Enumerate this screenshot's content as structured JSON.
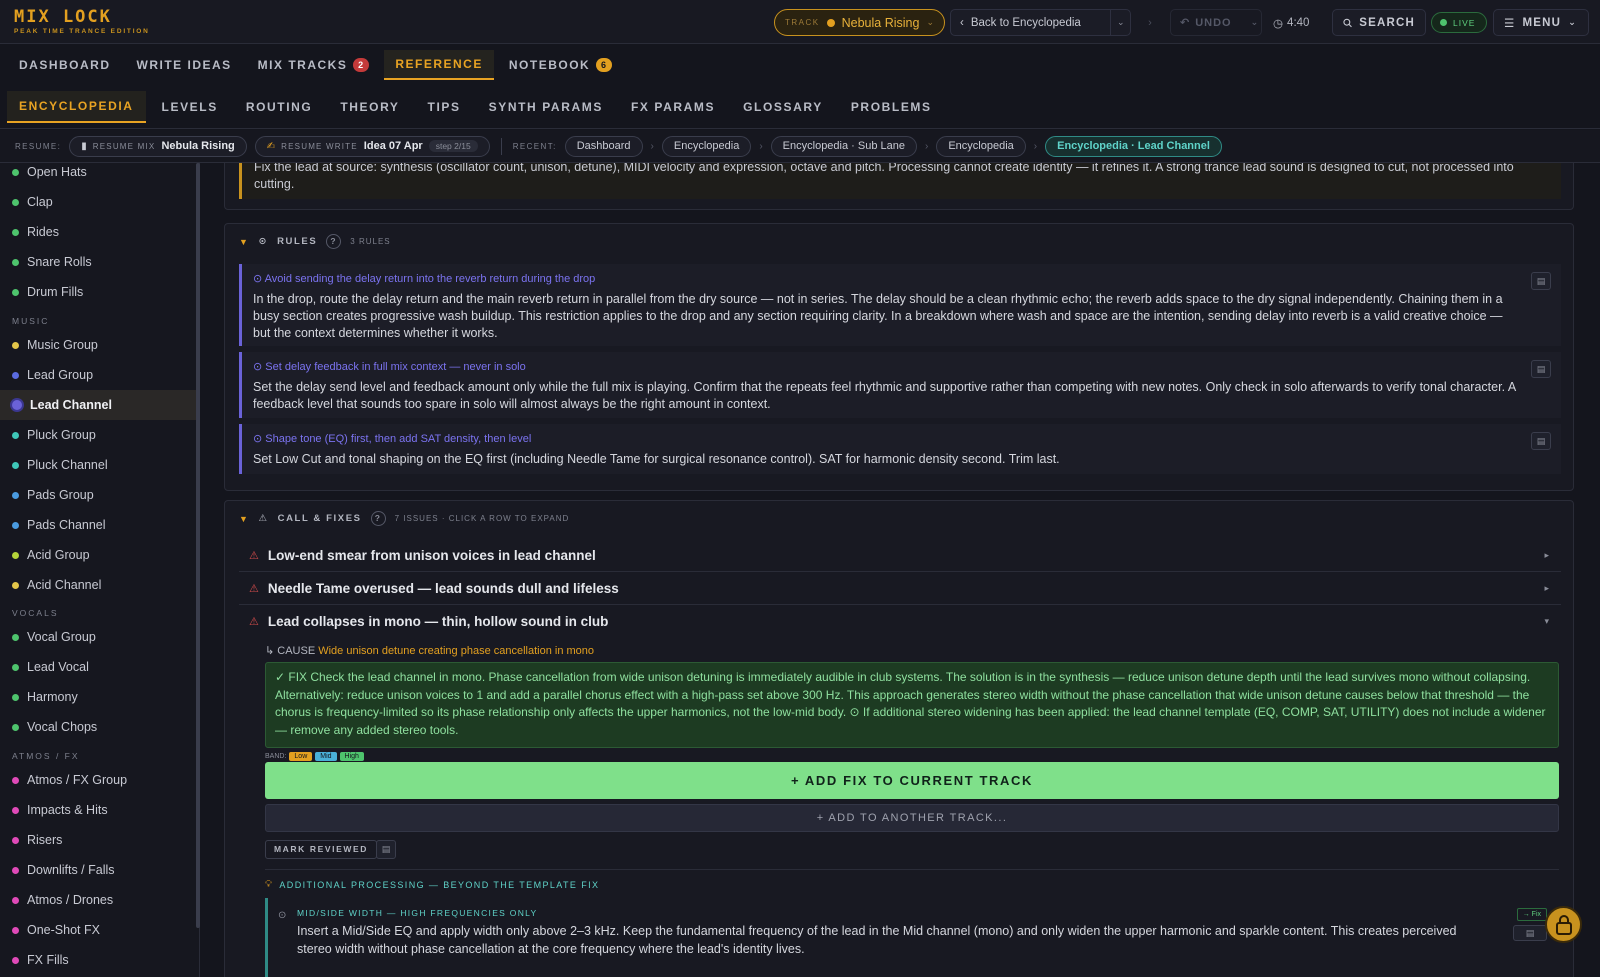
{
  "app": {
    "logo_title": "MIX LOCK",
    "logo_subtitle": "PEAK TIME TRANCE EDITION"
  },
  "topbar": {
    "track_label": "TRACK",
    "track_name": "Nebula Rising",
    "back_label": "Back to Encyclopedia",
    "undo_label": "UNDO",
    "time": "4:40",
    "search_label": "SEARCH",
    "live_label": "LIVE",
    "menu_label": "MENU"
  },
  "nav_primary": [
    {
      "label": "DASHBOARD",
      "badge": ""
    },
    {
      "label": "WRITE IDEAS",
      "badge": ""
    },
    {
      "label": "MIX TRACKS",
      "badge": "2"
    },
    {
      "label": "REFERENCE",
      "badge": "",
      "active": true
    },
    {
      "label": "NOTEBOOK",
      "badge": "6"
    }
  ],
  "nav_secondary": [
    "ENCYCLOPEDIA",
    "LEVELS",
    "ROUTING",
    "THEORY",
    "TIPS",
    "SYNTH PARAMS",
    "FX PARAMS",
    "GLOSSARY",
    "PROBLEMS"
  ],
  "resume": {
    "label": "RESUME:",
    "mix_small": "RESUME MIX",
    "mix_name": "Nebula Rising",
    "write_small": "RESUME WRITE",
    "write_name": "Idea 07 Apr",
    "write_step": "step 2/15",
    "recent_label": "RECENT:",
    "recent": [
      "Dashboard",
      "Encyclopedia",
      "Encyclopedia · Sub Lane",
      "Encyclopedia",
      "Encyclopedia · Lead Channel"
    ]
  },
  "sidebar": {
    "items_top": [
      {
        "label": "Open Hats",
        "color": "#4ec46d"
      },
      {
        "label": "Clap",
        "color": "#4ec46d"
      },
      {
        "label": "Rides",
        "color": "#4ec46d"
      },
      {
        "label": "Snare Rolls",
        "color": "#4ec46d"
      },
      {
        "label": "Drum Fills",
        "color": "#4ec46d"
      }
    ],
    "music_heading": "MUSIC",
    "music": [
      {
        "label": "Music Group",
        "color": "#e3c64a"
      },
      {
        "label": "Lead Group",
        "color": "#5a6be0"
      },
      {
        "label": "Lead Channel",
        "color": "#6a62d8",
        "active": true
      },
      {
        "label": "Pluck Group",
        "color": "#3fc7b8"
      },
      {
        "label": "Pluck Channel",
        "color": "#3fc7b8"
      },
      {
        "label": "Pads Group",
        "color": "#4a9be0"
      },
      {
        "label": "Pads Channel",
        "color": "#4a9be0"
      },
      {
        "label": "Acid Group",
        "color": "#b4d43a"
      },
      {
        "label": "Acid Channel",
        "color": "#e3c64a"
      }
    ],
    "vocals_heading": "VOCALS",
    "vocals": [
      {
        "label": "Vocal Group",
        "color": "#4ec46d"
      },
      {
        "label": "Lead Vocal",
        "color": "#4ec46d"
      },
      {
        "label": "Harmony",
        "color": "#4ec46d"
      },
      {
        "label": "Vocal Chops",
        "color": "#4ec46d"
      }
    ],
    "atmos_heading": "ATMOS / FX",
    "atmos": [
      {
        "label": "Atmos / FX Group",
        "color": "#e04ab8"
      },
      {
        "label": "Impacts & Hits",
        "color": "#e04ab8"
      },
      {
        "label": "Risers",
        "color": "#e04ab8"
      },
      {
        "label": "Downlifts / Falls",
        "color": "#e04ab8"
      },
      {
        "label": "Atmos / Drones",
        "color": "#e04ab8"
      },
      {
        "label": "One-Shot FX",
        "color": "#e04ab8"
      },
      {
        "label": "FX Fills",
        "color": "#e04ab8"
      }
    ]
  },
  "content": {
    "fix_source": "Fix the lead at source: synthesis (oscillator count, unison, detune), MIDI velocity and expression, octave and pitch. Processing cannot create identity — it refines it. A strong trance lead sound is designed to cut, not processed into cutting.",
    "rules_title": "RULES",
    "rules_count": "3 RULES",
    "rules": [
      {
        "title": "Avoid sending the delay return into the reverb return during the drop",
        "body": "In the drop, route the delay return and the main reverb return in parallel from the dry source — not in series. The delay should be a clean rhythmic echo; the reverb adds space to the dry signal independently. Chaining them in a busy section creates progressive wash buildup. This restriction applies to the drop and any section requiring clarity. In a breakdown where wash and space are the intention, sending delay into reverb is a valid creative choice — but the context determines whether it works."
      },
      {
        "title": "Set delay feedback in full mix context — never in solo",
        "body": "Set the delay send level and feedback amount only while the full mix is playing. Confirm that the repeats feel rhythmic and supportive rather than competing with new notes. Only check in solo afterwards to verify tonal character. A feedback level that sounds too spare in solo will almost always be the right amount in context."
      },
      {
        "title": "Shape tone (EQ) first, then add SAT density, then level",
        "body": "Set Low Cut and tonal shaping on the EQ first (including Needle Tame for surgical resonance control). SAT for harmonic density second. Trim last."
      }
    ],
    "calls_title": "CALL & FIXES",
    "calls_count": "7 ISSUES · CLICK A ROW TO EXPAND",
    "issues": [
      {
        "title": "Low-end smear from unison voices in lead channel",
        "chev": "▸"
      },
      {
        "title": "Needle Tame overused — lead sounds dull and lifeless",
        "chev": "▸"
      },
      {
        "title": "Lead collapses in mono — thin, hollow sound in club",
        "chev": "▾"
      }
    ],
    "cause_label": "↳ CAUSE",
    "cause_text": "Wide unison detune creating phase cancellation in mono",
    "fix_text": "✓ FIX Check the lead channel in mono. Phase cancellation from wide unison detuning is immediately audible in club systems. The solution is in the synthesis — reduce unison detune depth until the lead survives mono without collapsing. Alternatively: reduce unison voices to 1 and add a parallel chorus effect with a high-pass set above 300 Hz. This approach generates stereo width without the phase cancellation that wide unison detune causes below that threshold — the chorus is frequency-limited so its phase relationship only affects the upper harmonics, not the low-mid body. ⊙ If additional stereo widening has been applied: the lead channel template (EQ, COMP, SAT, UTILITY) does not include a widener — remove any added stereo tools.",
    "band_label": "BAND:",
    "bands": [
      {
        "label": "Low",
        "color": "#e3a020"
      },
      {
        "label": "Mid",
        "color": "#4ab0d8"
      },
      {
        "label": "High",
        "color": "#4ec46d"
      }
    ],
    "add_fix_label": "+ ADD FIX TO CURRENT TRACK",
    "add_another_label": "+ ADD TO ANOTHER TRACK...",
    "mark_reviewed_label": "MARK REVIEWED",
    "additional_label": "ADDITIONAL PROCESSING — BEYOND THE TEMPLATE FIX",
    "ms_title": "MID/SIDE WIDTH — HIGH FREQUENCIES ONLY",
    "ms_body": "Insert a Mid/Side EQ and apply width only above 2–3 kHz. Keep the fundamental frequency of the lead in the Mid channel (mono) and only widen the upper harmonic and sparkle content. This creates perceived stereo width without phase cancellation at the core frequency where the lead's identity lives.",
    "to_fix_label": "→ Fix"
  }
}
